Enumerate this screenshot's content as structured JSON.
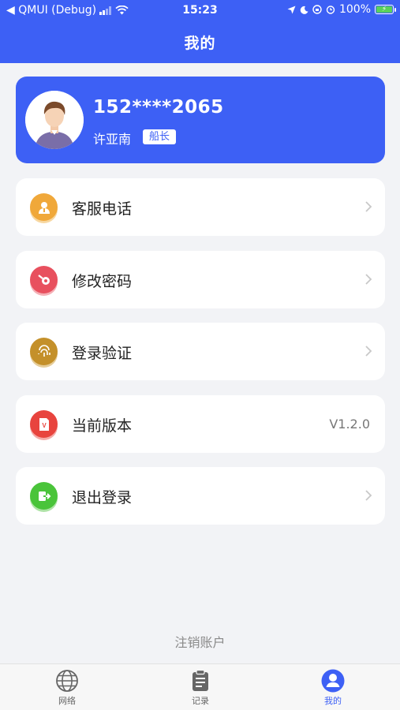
{
  "status_bar": {
    "carrier": "◀ QMUI (Debug)",
    "time": "15:23",
    "battery": "100%"
  },
  "header": {
    "title": "我的"
  },
  "profile": {
    "phone": "152****2065",
    "name": "许亚南",
    "role": "船长"
  },
  "menu": [
    {
      "label": "客服电话",
      "icon": "customer-service-icon",
      "color": "#f0a83a"
    },
    {
      "label": "修改密码",
      "icon": "key-icon",
      "color": "#e8505e"
    },
    {
      "label": "登录验证",
      "icon": "fingerprint-icon",
      "color": "#c4902a"
    },
    {
      "label": "当前版本",
      "icon": "version-icon",
      "color": "#e8443e",
      "value": "V1.2.0"
    },
    {
      "label": "退出登录",
      "icon": "logout-icon",
      "color": "#4ac43a"
    }
  ],
  "cancel_account": "注销账户",
  "tabs": [
    {
      "label": "网络",
      "icon": "globe-icon"
    },
    {
      "label": "记录",
      "icon": "clipboard-icon"
    },
    {
      "label": "我的",
      "icon": "user-icon",
      "active": true
    }
  ],
  "colors": {
    "primary": "#3d60f5",
    "background": "#f2f3f6"
  }
}
